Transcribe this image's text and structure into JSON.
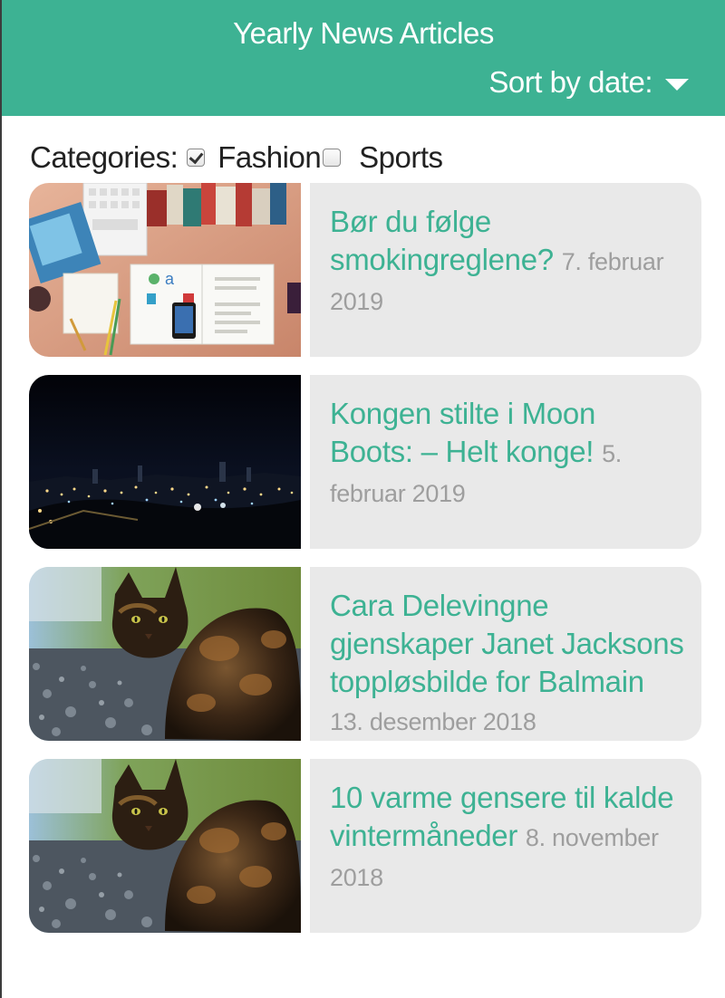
{
  "header": {
    "title": "Yearly News Articles",
    "sort_label": "Sort by date:"
  },
  "filters": {
    "label": "Categories:",
    "options": [
      {
        "label": "Fashion",
        "checked": true
      },
      {
        "label": "Sports",
        "checked": false
      }
    ]
  },
  "articles": [
    {
      "title": "Bør du følge smokingreglene?",
      "date": "7. februar 2019",
      "image": "desk-workspace-photo"
    },
    {
      "title": "Kongen stilte i Moon Boots: – Helt konge!",
      "date": "5. februar 2019",
      "image": "city-night-skyline-photo"
    },
    {
      "title": "Cara Delevingne gjenskaper Janet Jacksons toppløsbilde for Balmain",
      "date": "13. desember 2018",
      "image": "tortoiseshell-cat-photo"
    },
    {
      "title": "10 varme gensere til kalde vintermåneder",
      "date": "8. november 2018",
      "image": "tortoiseshell-cat-photo"
    }
  ],
  "colors": {
    "accent": "#3db293",
    "card_bg": "#e9e9e9",
    "date_text": "#9e9e9e"
  }
}
